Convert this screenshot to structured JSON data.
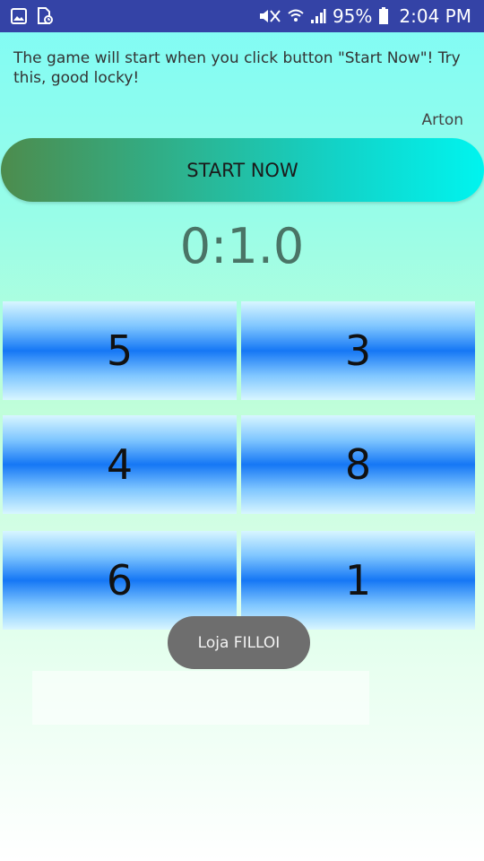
{
  "status_bar": {
    "battery_percent": "95%",
    "time": "2:04 PM",
    "left_icons": [
      "image-icon",
      "file-icon"
    ],
    "right_icons": [
      "mute-icon",
      "wifi-icon",
      "signal-icon",
      "battery-icon"
    ]
  },
  "instructions": "The game will start when you click button \"Start Now\"! Try this, good locky!",
  "author": "Arton",
  "start_button_label": "START NOW",
  "timer": "0:1.0",
  "tiles": [
    "5",
    "3",
    "4",
    "8",
    "6",
    "1"
  ],
  "toast": "Loja FILLOI",
  "colors": {
    "status_bar": "#3443a6",
    "timer": "#4a7466",
    "tile_center": "#1577f5",
    "button_left": "#4d8c4d",
    "button_right": "#00f4ef"
  }
}
